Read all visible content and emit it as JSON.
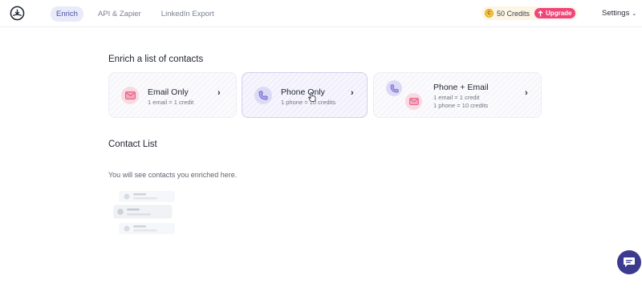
{
  "nav": {
    "tabs": [
      {
        "label": "Enrich",
        "active": true
      },
      {
        "label": "API & Zapier",
        "active": false
      },
      {
        "label": "LinkedIn Export",
        "active": false
      }
    ],
    "credits_label": "50 Credits",
    "coin_symbol": "C",
    "upgrade_label": "Upgrade",
    "upgrade_icon": "arrow-up-icon",
    "settings_label": "Settings",
    "settings_chevron": "⌄"
  },
  "enrich": {
    "title": "Enrich a list of contacts",
    "options": [
      {
        "title": "Email Only",
        "lines": [
          "1 email = 1 credit"
        ],
        "icon": "mail-icon"
      },
      {
        "title": "Phone Only",
        "lines": [
          "1 phone = 10 credits"
        ],
        "icon": "phone-icon"
      },
      {
        "title": "Phone + Email",
        "lines": [
          "1 email = 1 credit",
          "1 phone = 10 credits"
        ],
        "icon": "phone-mail-icon"
      }
    ],
    "chevron": "›"
  },
  "contacts": {
    "title": "Contact List",
    "empty_text": "You will see contacts you enriched here."
  },
  "colors": {
    "accent": "#4950a8",
    "upgrade": "#f0457a",
    "chat": "#3b3a8f"
  }
}
